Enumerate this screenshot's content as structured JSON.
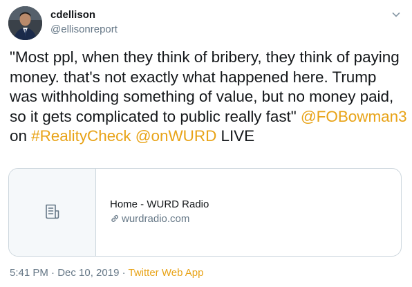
{
  "user": {
    "display_name": "cdellison",
    "handle": "@ellisonreport"
  },
  "tweet": {
    "text_1": "\"Most ppl, when they think of bribery, they think of paying money. that's not exactly what happened here. Trump was withholding something of value, but no money paid, so it gets complicated to public really fast\" ",
    "mention_1": "@FOBowman3",
    "text_2": " on ",
    "hashtag": "#RealityCheck",
    "text_3": " ",
    "mention_2": "@onWURD",
    "text_4": " LIVE"
  },
  "card": {
    "title": "Home - WURD Radio",
    "domain": "wurdradio.com",
    "icon": "article-icon"
  },
  "meta": {
    "timestamp": "5:41 PM · Dec 10, 2019",
    "separator": " · ",
    "source": "Twitter Web App"
  },
  "colors": {
    "link": "#e8a317",
    "text": "#14171a",
    "secondary": "#657786",
    "border": "#ccd6dd"
  }
}
